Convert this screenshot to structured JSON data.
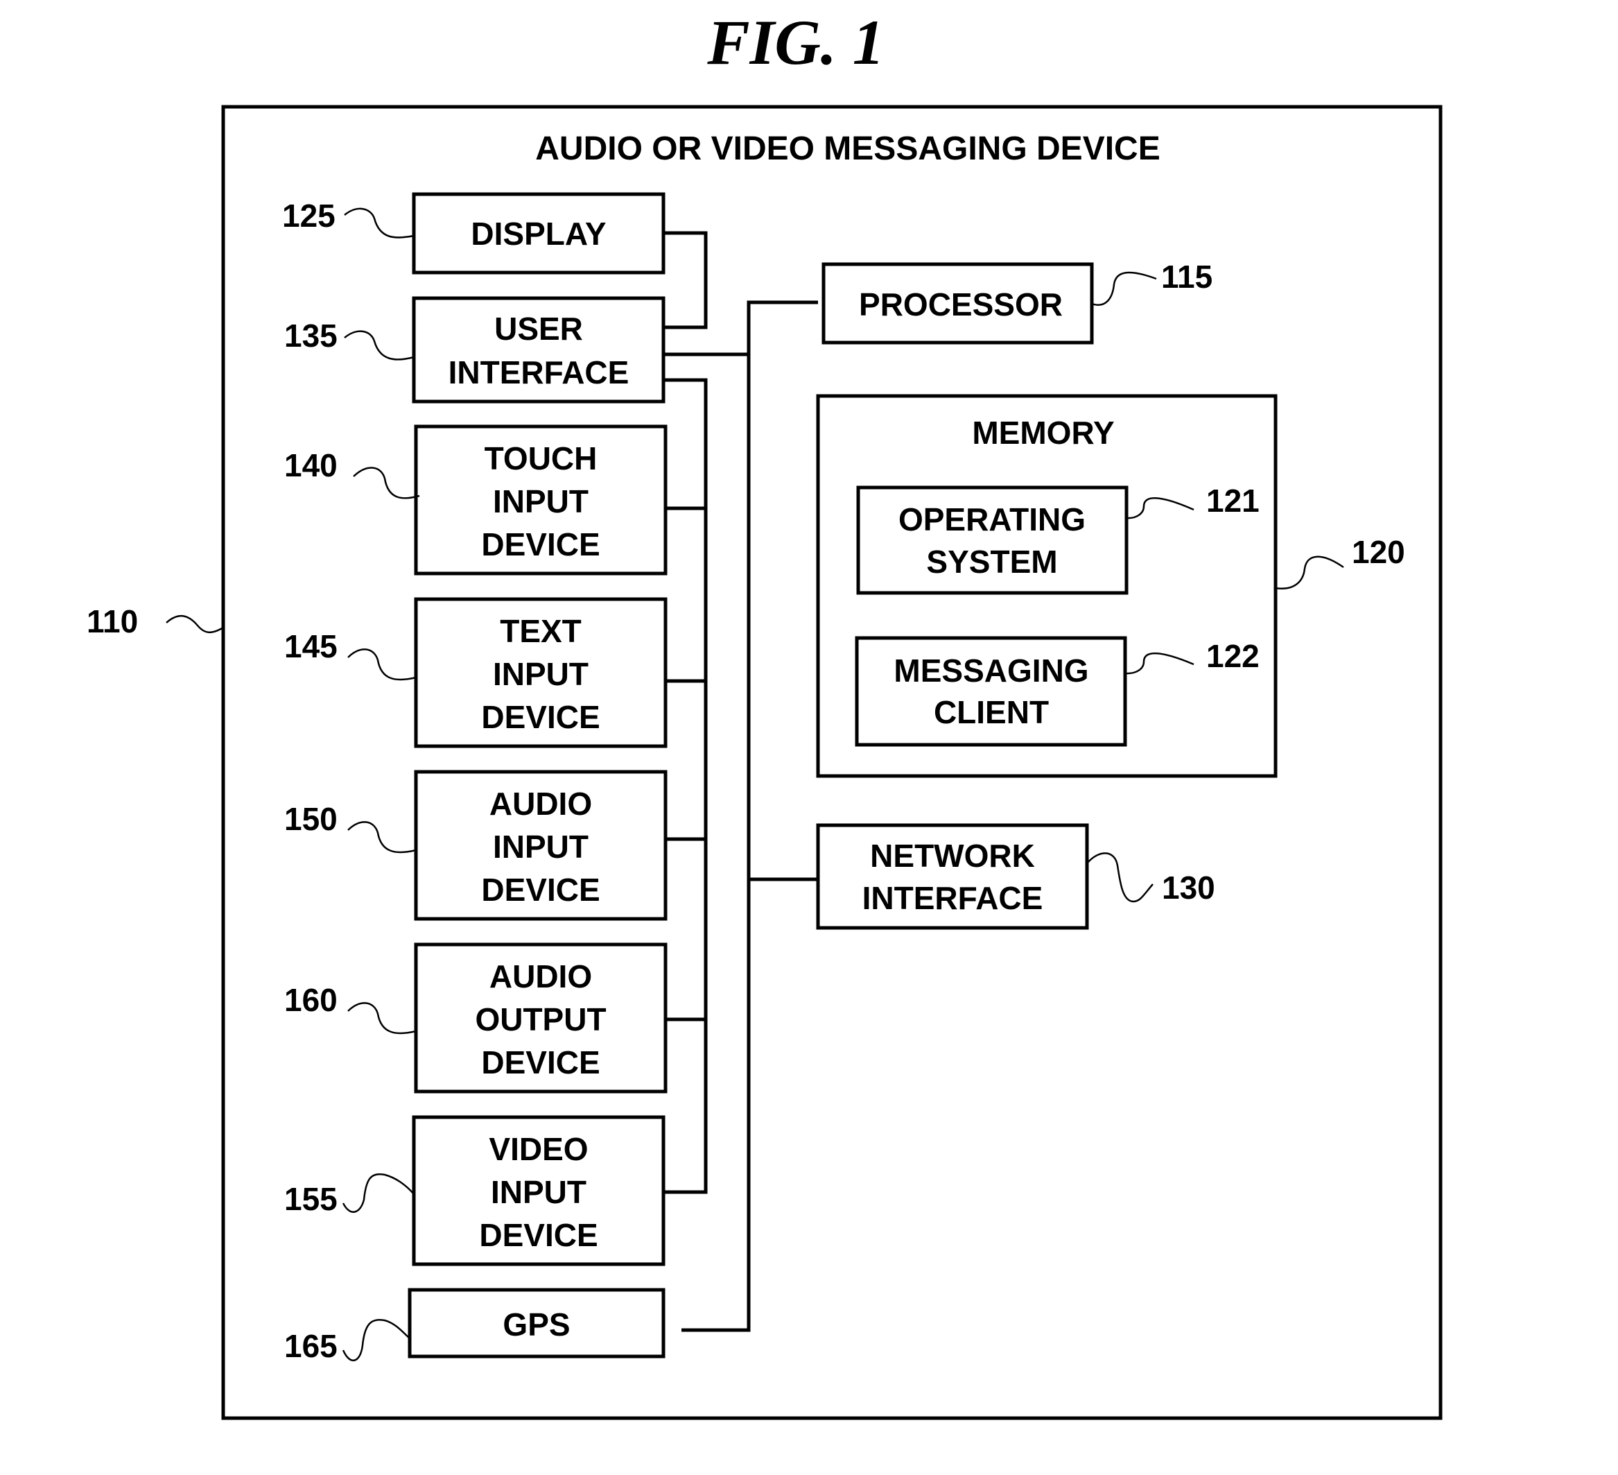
{
  "figure": {
    "title": "FIG. 1",
    "device": {
      "label": "AUDIO OR VIDEO MESSAGING DEVICE",
      "ref": "110"
    },
    "components": {
      "display": {
        "lines": [
          "DISPLAY"
        ],
        "ref": "125"
      },
      "user_interface": {
        "lines": [
          "USER",
          "INTERFACE"
        ],
        "ref": "135"
      },
      "touch_input": {
        "lines": [
          "TOUCH",
          "INPUT",
          "DEVICE"
        ],
        "ref": "140"
      },
      "text_input": {
        "lines": [
          "TEXT",
          "INPUT",
          "DEVICE"
        ],
        "ref": "145"
      },
      "audio_input": {
        "lines": [
          "AUDIO",
          "INPUT",
          "DEVICE"
        ],
        "ref": "150"
      },
      "audio_output": {
        "lines": [
          "AUDIO",
          "OUTPUT",
          "DEVICE"
        ],
        "ref": "160"
      },
      "video_input": {
        "lines": [
          "VIDEO",
          "INPUT",
          "DEVICE"
        ],
        "ref": "155"
      },
      "gps": {
        "lines": [
          "GPS"
        ],
        "ref": "165"
      },
      "processor": {
        "lines": [
          "PROCESSOR"
        ],
        "ref": "115"
      },
      "memory": {
        "label": "MEMORY",
        "ref": "120"
      },
      "operating_system": {
        "lines": [
          "OPERATING",
          "SYSTEM"
        ],
        "ref": "121"
      },
      "messaging_client": {
        "lines": [
          "MESSAGING",
          "CLIENT"
        ],
        "ref": "122"
      },
      "network_interface": {
        "lines": [
          "NETWORK",
          "INTERFACE"
        ],
        "ref": "130"
      }
    }
  }
}
